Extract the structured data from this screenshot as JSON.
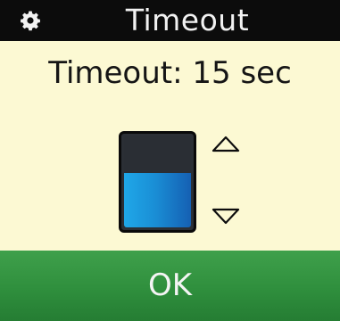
{
  "header": {
    "title": "Timeout",
    "icon": "gear-icon"
  },
  "status": {
    "text": "Timeout: 15 sec"
  },
  "level": {
    "fraction": 0.6
  },
  "controls": {
    "up_icon": "up-arrow-icon",
    "down_icon": "down-arrow-icon"
  },
  "ok_button": {
    "label": "OK"
  },
  "colors": {
    "title_bar": "#0c0c0c",
    "background": "#fcf9d3",
    "ok_green": "#2f8f3d",
    "level_blue": "#1a8fd6",
    "level_empty": "#2b2f35"
  }
}
